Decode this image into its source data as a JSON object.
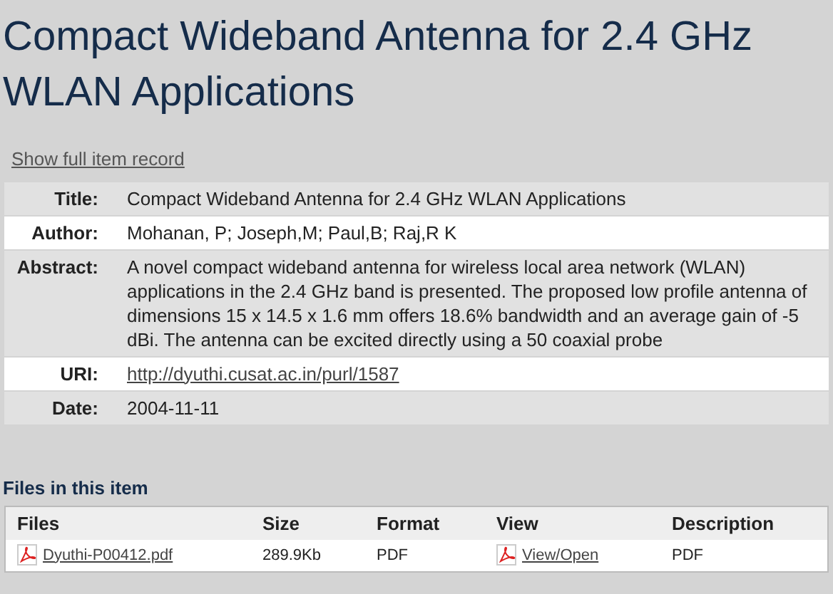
{
  "heading": "Compact Wideband Antenna for 2.4 GHz WLAN Applications",
  "full_record_link": "Show full item record",
  "fields": [
    {
      "label": "Title:",
      "value": "Compact Wideband Antenna for 2.4 GHz WLAN Applications",
      "kind": "text"
    },
    {
      "label": "Author:",
      "value": "Mohanan, P; Joseph,M; Paul,B; Raj,R K",
      "kind": "text"
    },
    {
      "label": "Abstract:",
      "value": "A novel compact wideband antenna for wireless local area network (WLAN) applications in the 2.4 GHz band is presented. The proposed low profile antenna of dimensions 15 x 14.5 x 1.6 mm offers 18.6% bandwidth and an average gain of -5 dBi. The antenna can be excited directly using a 50 coaxial probe",
      "kind": "text"
    },
    {
      "label": "URI:",
      "value": "http://dyuthi.cusat.ac.in/purl/1587",
      "kind": "link"
    },
    {
      "label": "Date:",
      "value": "2004-11-11",
      "kind": "text"
    }
  ],
  "files_heading": "Files in this item",
  "files_table": {
    "columns": [
      "Files",
      "Size",
      "Format",
      "View",
      "Description"
    ],
    "rows": [
      {
        "file": "Dyuthi-P00412.pdf",
        "size": "289.9Kb",
        "format": "PDF",
        "view": "View/Open",
        "description": "PDF"
      }
    ]
  }
}
